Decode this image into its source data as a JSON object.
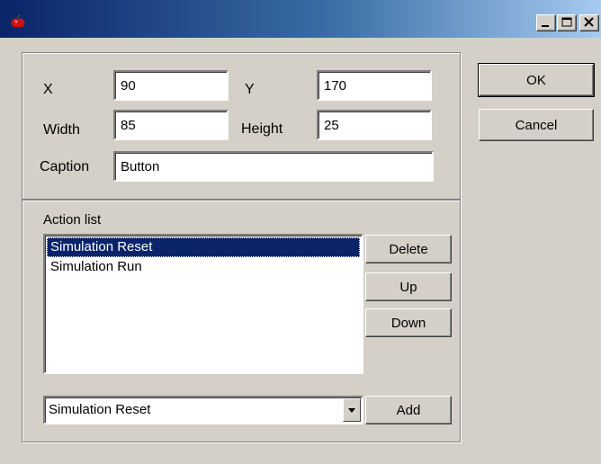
{
  "window": {
    "title": "",
    "icon": "apple-icon",
    "controls": {
      "minimize": "minimize-icon",
      "maximize": "maximize-icon",
      "close": "close-icon"
    },
    "accent_color": "#0a246a"
  },
  "geometry": {
    "x_label": "X",
    "x_value": "90",
    "y_label": "Y",
    "y_value": "170",
    "width_label": "Width",
    "width_value": "85",
    "height_label": "Height",
    "height_value": "25",
    "caption_label": "Caption",
    "caption_value": "Button"
  },
  "actions": {
    "label": "Action list",
    "items": [
      "Simulation Reset",
      "Simulation Run"
    ],
    "selected_index": 0,
    "delete_label": "Delete",
    "up_label": "Up",
    "down_label": "Down",
    "combo_value": "Simulation Reset",
    "add_label": "Add"
  },
  "dialog": {
    "ok_label": "OK",
    "cancel_label": "Cancel"
  }
}
